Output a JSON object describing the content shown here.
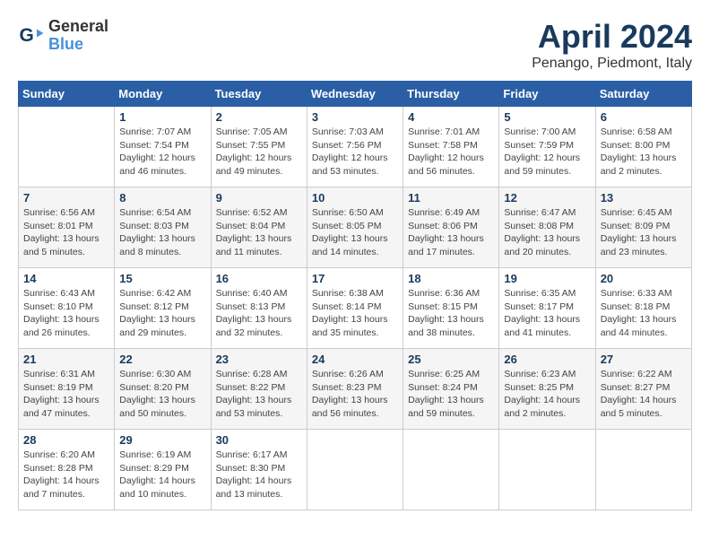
{
  "logo": {
    "text_line1": "General",
    "text_line2": "Blue"
  },
  "title": "April 2024",
  "subtitle": "Penango, Piedmont, Italy",
  "days_of_week": [
    "Sunday",
    "Monday",
    "Tuesday",
    "Wednesday",
    "Thursday",
    "Friday",
    "Saturday"
  ],
  "weeks": [
    [
      {
        "day": "",
        "info": ""
      },
      {
        "day": "1",
        "info": "Sunrise: 7:07 AM\nSunset: 7:54 PM\nDaylight: 12 hours\nand 46 minutes."
      },
      {
        "day": "2",
        "info": "Sunrise: 7:05 AM\nSunset: 7:55 PM\nDaylight: 12 hours\nand 49 minutes."
      },
      {
        "day": "3",
        "info": "Sunrise: 7:03 AM\nSunset: 7:56 PM\nDaylight: 12 hours\nand 53 minutes."
      },
      {
        "day": "4",
        "info": "Sunrise: 7:01 AM\nSunset: 7:58 PM\nDaylight: 12 hours\nand 56 minutes."
      },
      {
        "day": "5",
        "info": "Sunrise: 7:00 AM\nSunset: 7:59 PM\nDaylight: 12 hours\nand 59 minutes."
      },
      {
        "day": "6",
        "info": "Sunrise: 6:58 AM\nSunset: 8:00 PM\nDaylight: 13 hours\nand 2 minutes."
      }
    ],
    [
      {
        "day": "7",
        "info": "Sunrise: 6:56 AM\nSunset: 8:01 PM\nDaylight: 13 hours\nand 5 minutes."
      },
      {
        "day": "8",
        "info": "Sunrise: 6:54 AM\nSunset: 8:03 PM\nDaylight: 13 hours\nand 8 minutes."
      },
      {
        "day": "9",
        "info": "Sunrise: 6:52 AM\nSunset: 8:04 PM\nDaylight: 13 hours\nand 11 minutes."
      },
      {
        "day": "10",
        "info": "Sunrise: 6:50 AM\nSunset: 8:05 PM\nDaylight: 13 hours\nand 14 minutes."
      },
      {
        "day": "11",
        "info": "Sunrise: 6:49 AM\nSunset: 8:06 PM\nDaylight: 13 hours\nand 17 minutes."
      },
      {
        "day": "12",
        "info": "Sunrise: 6:47 AM\nSunset: 8:08 PM\nDaylight: 13 hours\nand 20 minutes."
      },
      {
        "day": "13",
        "info": "Sunrise: 6:45 AM\nSunset: 8:09 PM\nDaylight: 13 hours\nand 23 minutes."
      }
    ],
    [
      {
        "day": "14",
        "info": "Sunrise: 6:43 AM\nSunset: 8:10 PM\nDaylight: 13 hours\nand 26 minutes."
      },
      {
        "day": "15",
        "info": "Sunrise: 6:42 AM\nSunset: 8:12 PM\nDaylight: 13 hours\nand 29 minutes."
      },
      {
        "day": "16",
        "info": "Sunrise: 6:40 AM\nSunset: 8:13 PM\nDaylight: 13 hours\nand 32 minutes."
      },
      {
        "day": "17",
        "info": "Sunrise: 6:38 AM\nSunset: 8:14 PM\nDaylight: 13 hours\nand 35 minutes."
      },
      {
        "day": "18",
        "info": "Sunrise: 6:36 AM\nSunset: 8:15 PM\nDaylight: 13 hours\nand 38 minutes."
      },
      {
        "day": "19",
        "info": "Sunrise: 6:35 AM\nSunset: 8:17 PM\nDaylight: 13 hours\nand 41 minutes."
      },
      {
        "day": "20",
        "info": "Sunrise: 6:33 AM\nSunset: 8:18 PM\nDaylight: 13 hours\nand 44 minutes."
      }
    ],
    [
      {
        "day": "21",
        "info": "Sunrise: 6:31 AM\nSunset: 8:19 PM\nDaylight: 13 hours\nand 47 minutes."
      },
      {
        "day": "22",
        "info": "Sunrise: 6:30 AM\nSunset: 8:20 PM\nDaylight: 13 hours\nand 50 minutes."
      },
      {
        "day": "23",
        "info": "Sunrise: 6:28 AM\nSunset: 8:22 PM\nDaylight: 13 hours\nand 53 minutes."
      },
      {
        "day": "24",
        "info": "Sunrise: 6:26 AM\nSunset: 8:23 PM\nDaylight: 13 hours\nand 56 minutes."
      },
      {
        "day": "25",
        "info": "Sunrise: 6:25 AM\nSunset: 8:24 PM\nDaylight: 13 hours\nand 59 minutes."
      },
      {
        "day": "26",
        "info": "Sunrise: 6:23 AM\nSunset: 8:25 PM\nDaylight: 14 hours\nand 2 minutes."
      },
      {
        "day": "27",
        "info": "Sunrise: 6:22 AM\nSunset: 8:27 PM\nDaylight: 14 hours\nand 5 minutes."
      }
    ],
    [
      {
        "day": "28",
        "info": "Sunrise: 6:20 AM\nSunset: 8:28 PM\nDaylight: 14 hours\nand 7 minutes."
      },
      {
        "day": "29",
        "info": "Sunrise: 6:19 AM\nSunset: 8:29 PM\nDaylight: 14 hours\nand 10 minutes."
      },
      {
        "day": "30",
        "info": "Sunrise: 6:17 AM\nSunset: 8:30 PM\nDaylight: 14 hours\nand 13 minutes."
      },
      {
        "day": "",
        "info": ""
      },
      {
        "day": "",
        "info": ""
      },
      {
        "day": "",
        "info": ""
      },
      {
        "day": "",
        "info": ""
      }
    ]
  ]
}
